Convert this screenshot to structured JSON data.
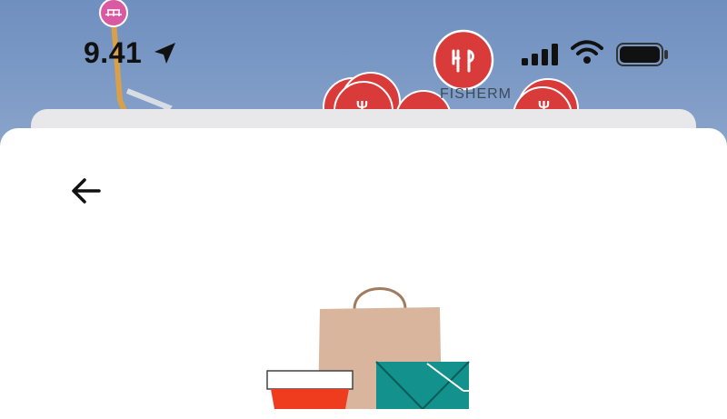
{
  "status_bar": {
    "time": "9.41"
  },
  "map": {
    "poi_label": "FISHERM"
  },
  "colors": {
    "map_blue": "#7b97c2",
    "restaurant_pin": "#d93a3a",
    "sheet": "#ffffff"
  },
  "icons": {
    "back": "arrow-left-icon",
    "location": "location-arrow-icon",
    "restaurant": "fork-knife-icon"
  }
}
